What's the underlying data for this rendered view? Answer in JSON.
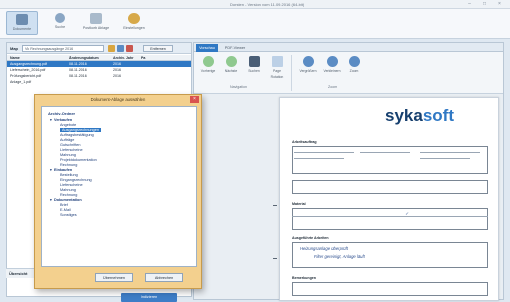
{
  "window": {
    "title": "Dorsten - Version vom 11.09.2016 (64-bit)",
    "controls": [
      "–",
      "□",
      "×"
    ]
  },
  "ribbon": {
    "buttons": [
      {
        "label": "Dokumente",
        "icon": "documents-icon",
        "active": true
      },
      {
        "label": "Suche",
        "icon": "search-icon",
        "active": false
      },
      {
        "label": "Postkorb Ablage",
        "icon": "inbox-icon",
        "active": false
      },
      {
        "label": "Einstellungen",
        "icon": "settings-icon",
        "active": false
      }
    ]
  },
  "left": {
    "filter_label": "Map",
    "filter_value": "Vk Rechnungsausgänge 2016",
    "remove_label": "Entfernen",
    "columns": [
      "Name",
      "Änderungsdatum",
      "Archiv. Jahr",
      "Pa"
    ],
    "rows": [
      [
        "Ausgangsrechnung.pdf",
        "08.11.2016",
        "2016",
        ""
      ],
      [
        "Lieferschein_2016.pdf",
        "08.11.2016",
        "2016",
        ""
      ],
      [
        "Prüfungsbericht.pdf",
        "08.11.2016",
        "2016",
        ""
      ],
      [
        "Anlage_1.pdf",
        "",
        "",
        ""
      ]
    ],
    "bottom_label": "Übersicht",
    "bottom_button": "Indizieren"
  },
  "right": {
    "tabs": [
      "Vorschau",
      "PDF-Viewer"
    ],
    "toolbar": [
      {
        "label": "Vorherige",
        "icon": "previous-icon"
      },
      {
        "label": "Nächste",
        "icon": "next-icon"
      },
      {
        "label": "Suchen",
        "icon": "binoculars-icon"
      },
      {
        "label": "Page Rotation",
        "icon": "page-rotate-icon"
      },
      {
        "label": "Vergrößern",
        "icon": "zoom-in-icon"
      },
      {
        "label": "Verkleinern",
        "icon": "zoom-out-icon"
      },
      {
        "label": "Zoom",
        "icon": "zoom-icon"
      }
    ],
    "groups": [
      "Navigation",
      "Zoom"
    ],
    "document": {
      "logo_main": "sykasoft",
      "logo_accent": "soft",
      "sections": [
        "Arbeitsauftrag",
        "Ausgeführte Arbeiten",
        "Material",
        "Bemerkungen"
      ],
      "handwriting": [
        "Heizungsanlage überprüft",
        "Filter gereinigt, Anlage läuft"
      ]
    }
  },
  "dialog": {
    "title": "Dokument-Ablage auswählen",
    "close": "×",
    "root": "Archiv-Ordner",
    "tree": [
      {
        "level": 1,
        "label": "Verkaufen",
        "toggle": "▾"
      },
      {
        "level": 2,
        "label": "Angebote"
      },
      {
        "level": 2,
        "label": "Ausgangsrechnungen",
        "selected": true
      },
      {
        "level": 2,
        "label": "Auftragsbestätigung"
      },
      {
        "level": 2,
        "label": "Aufträge"
      },
      {
        "level": 2,
        "label": "Gutschriften"
      },
      {
        "level": 2,
        "label": "Lieferscheine"
      },
      {
        "level": 2,
        "label": "Mahnung"
      },
      {
        "level": 2,
        "label": "Projektdokumentation"
      },
      {
        "level": 2,
        "label": "Rechnung"
      },
      {
        "level": 1,
        "label": "Einkaufen",
        "toggle": "▾"
      },
      {
        "level": 2,
        "label": "Bestellung"
      },
      {
        "level": 2,
        "label": "Eingangsrechnung"
      },
      {
        "level": 2,
        "label": "Lieferscheine"
      },
      {
        "level": 2,
        "label": "Mahnung"
      },
      {
        "level": 2,
        "label": "Rechnung"
      },
      {
        "level": 1,
        "label": "Dokumentation",
        "toggle": "▾"
      },
      {
        "level": 2,
        "label": "Brief"
      },
      {
        "level": 2,
        "label": "E-Mail"
      },
      {
        "level": 2,
        "label": "Sonstiges"
      }
    ],
    "ok_label": "Übernehmen",
    "cancel_label": "Abbrechen"
  },
  "colors": {
    "accent": "#2f78c4",
    "dialog_bg": "#f3d08e",
    "logo": "#163f6e"
  }
}
